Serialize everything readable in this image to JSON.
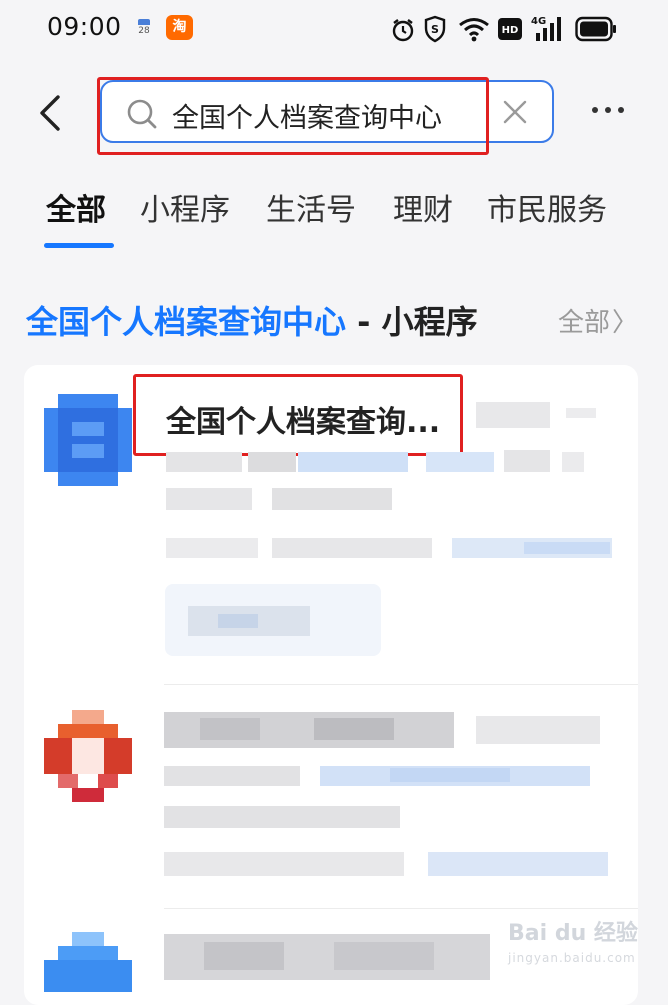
{
  "status_bar": {
    "time": "09:00",
    "calendar_day": "28",
    "taobao_badge": "淘"
  },
  "search": {
    "value": "全国个人档案查询中心"
  },
  "tabs": [
    {
      "label": "全部",
      "active": true
    },
    {
      "label": "小程序",
      "active": false
    },
    {
      "label": "生活号",
      "active": false
    },
    {
      "label": "理财",
      "active": false
    },
    {
      "label": "市民服务",
      "active": false
    }
  ],
  "section": {
    "title_highlight": "全国个人档案查询中心",
    "title_suffix": " - 小程序",
    "all_label": "全部",
    "all_chevron": "〉"
  },
  "results": [
    {
      "title": "全国个人档案查询...",
      "icon": "blurred-blue-app-icon"
    },
    {
      "title": "",
      "icon": "blurred-red-app-icon"
    },
    {
      "title": "",
      "icon": "blurred-blue-app-icon"
    }
  ],
  "watermark": {
    "brand": "Bai du 经验",
    "url": "jingyan.baidu.com"
  },
  "colors": {
    "accent": "#1677ff",
    "highlight_box": "#e02020"
  }
}
